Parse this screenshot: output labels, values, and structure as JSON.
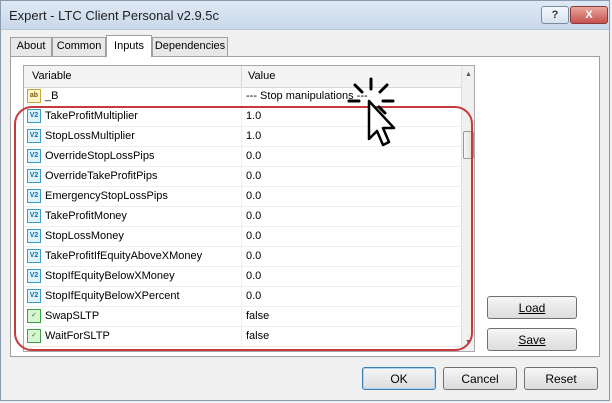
{
  "window": {
    "title": "Expert - LTC Client Personal v2.9.5c",
    "help_label": "?",
    "close_label": "X"
  },
  "tabs": [
    {
      "label": "About"
    },
    {
      "label": "Common"
    },
    {
      "label": "Inputs"
    },
    {
      "label": "Dependencies"
    }
  ],
  "grid": {
    "columns": [
      "Variable",
      "Value"
    ],
    "rows": [
      {
        "icon": "ab",
        "name": "_B",
        "value": "--- Stop manipulations ---"
      },
      {
        "icon": "V2",
        "name": "TakeProfitMultiplier",
        "value": "1.0"
      },
      {
        "icon": "V2",
        "name": "StopLossMultiplier",
        "value": "1.0"
      },
      {
        "icon": "V2",
        "name": "OverrideStopLossPips",
        "value": "0.0"
      },
      {
        "icon": "V2",
        "name": "OverrideTakeProfitPips",
        "value": "0.0"
      },
      {
        "icon": "V2",
        "name": "EmergencyStopLossPips",
        "value": "0.0"
      },
      {
        "icon": "V2",
        "name": "TakeProfitMoney",
        "value": "0.0"
      },
      {
        "icon": "V2",
        "name": "StopLossMoney",
        "value": "0.0"
      },
      {
        "icon": "V2",
        "name": "TakeProfitIfEquityAboveXMoney",
        "value": "0.0"
      },
      {
        "icon": "V2",
        "name": "StopIfEquityBelowXMoney",
        "value": "0.0"
      },
      {
        "icon": "V2",
        "name": "StopIfEquityBelowXPercent",
        "value": "0.0"
      },
      {
        "icon": "✓",
        "name": "SwapSLTP",
        "value": "false"
      },
      {
        "icon": "✓",
        "name": "WaitForSLTP",
        "value": "false"
      }
    ]
  },
  "side_buttons": {
    "load": "Load",
    "save": "Save"
  },
  "bottom_buttons": {
    "ok": "OK",
    "cancel": "Cancel",
    "reset": "Reset"
  }
}
